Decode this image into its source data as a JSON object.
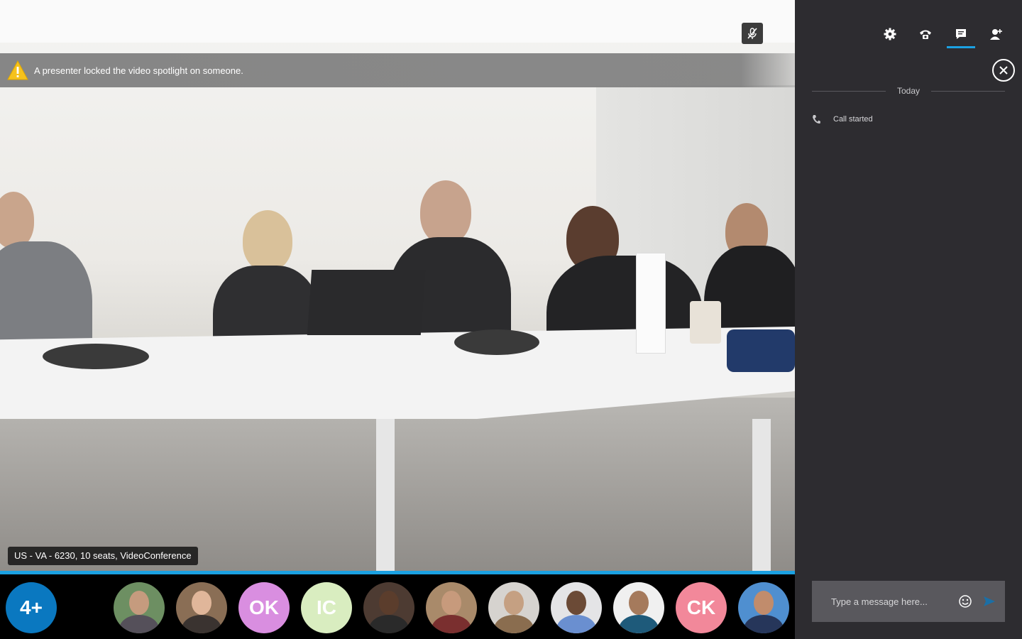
{
  "banner": {
    "message": "A presenter locked the video spotlight on someone.",
    "icon": "warning-icon"
  },
  "video": {
    "location_label": "US - VA - 6230, 10 seats, VideoConference",
    "mute_icon": "microphone-muted-icon"
  },
  "participants": {
    "overflow_label": "4+",
    "overflow_color": "#0a78c0",
    "items": [
      {
        "type": "photo",
        "name": "participant-1"
      },
      {
        "type": "photo",
        "name": "participant-2"
      },
      {
        "type": "initials",
        "initials": "OK",
        "color": "#d98ee0"
      },
      {
        "type": "initials",
        "initials": "IC",
        "color": "#d9edc0"
      },
      {
        "type": "photo",
        "name": "participant-5"
      },
      {
        "type": "photo",
        "name": "participant-6"
      },
      {
        "type": "photo",
        "name": "participant-7"
      },
      {
        "type": "photo",
        "name": "participant-8"
      },
      {
        "type": "photo",
        "name": "participant-9"
      },
      {
        "type": "initials",
        "initials": "CK",
        "color": "#f2889a"
      },
      {
        "type": "photo",
        "name": "participant-11"
      }
    ]
  },
  "panel": {
    "tabs": [
      {
        "name": "settings",
        "icon": "gear-icon"
      },
      {
        "name": "call-controls",
        "icon": "phone-icon"
      },
      {
        "name": "chat",
        "icon": "chat-icon",
        "active": true
      },
      {
        "name": "add-people",
        "icon": "add-person-icon"
      }
    ],
    "date_separator": "Today",
    "events": [
      {
        "icon": "phone-icon",
        "text": "Call started"
      }
    ],
    "compose": {
      "placeholder": "Type a message here..."
    }
  },
  "colors": {
    "accent": "#1ba1e2",
    "panel_bg": "#2d2c30",
    "compose_bg": "#59585d"
  }
}
